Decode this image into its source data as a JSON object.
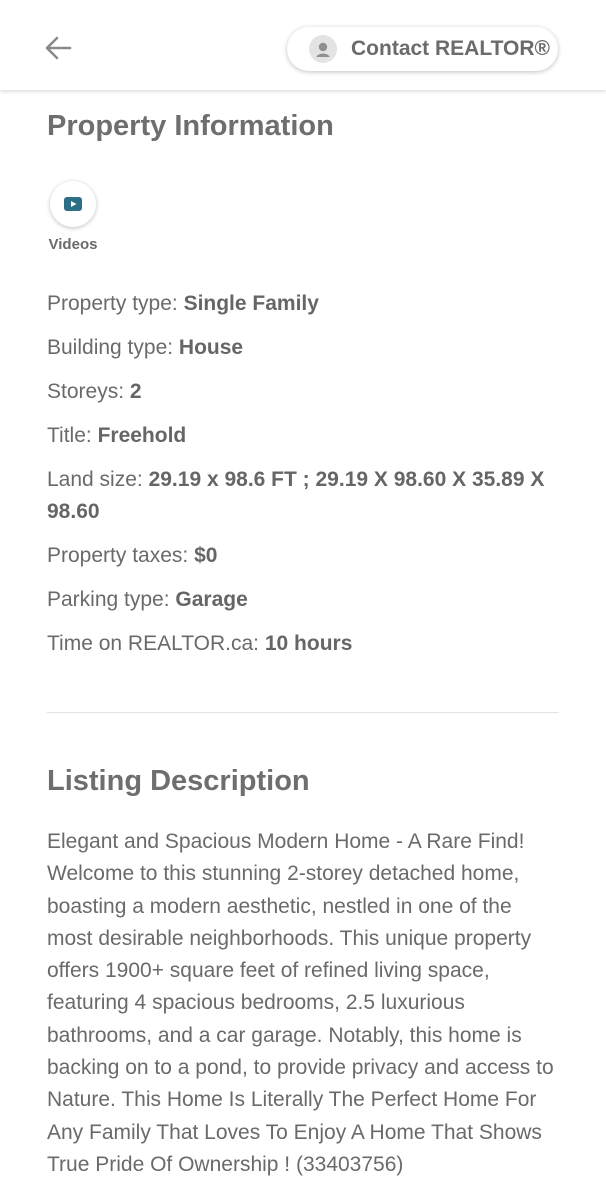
{
  "header": {
    "back_icon": "arrow-left-icon",
    "contact_button_label": "Contact REALTOR®",
    "contact_icon": "realtor-avatar-icon"
  },
  "property_information": {
    "title": "Property Information",
    "media": {
      "videos_label": "Videos",
      "videos_icon": "play-video-icon",
      "icon_color": "#2d6f86"
    },
    "details": [
      {
        "label": "Property type: ",
        "value": "Single Family"
      },
      {
        "label": "Building type: ",
        "value": "House"
      },
      {
        "label": "Storeys: ",
        "value": "2"
      },
      {
        "label": "Title: ",
        "value": "Freehold"
      },
      {
        "label": "Land size: ",
        "value": "29.19 x 98.6 FT ; 29.19 X 98.60 X 35.89 X 98.60"
      },
      {
        "label": "Property taxes: ",
        "value": "$0"
      },
      {
        "label": "Parking type: ",
        "value": "Garage"
      },
      {
        "label": "Time on REALTOR.ca: ",
        "value": "10 hours"
      }
    ]
  },
  "listing_description": {
    "title": "Listing Description",
    "body": "Elegant and Spacious Modern Home - A Rare Find! Welcome to this stunning 2-storey detached home, boasting a modern aesthetic, nestled in one of the most desirable neighborhoods. This unique property offers 1900+ square feet of refined living space, featuring 4 spacious bedrooms, 2.5 luxurious bathrooms, and a car garage. Notably, this home is backing on to a pond, to provide privacy and access to Nature. This Home Is Literally The Perfect Home For Any Family That Loves To Enjoy A Home That Shows True Pride Of Ownership ! (33403756)"
  }
}
